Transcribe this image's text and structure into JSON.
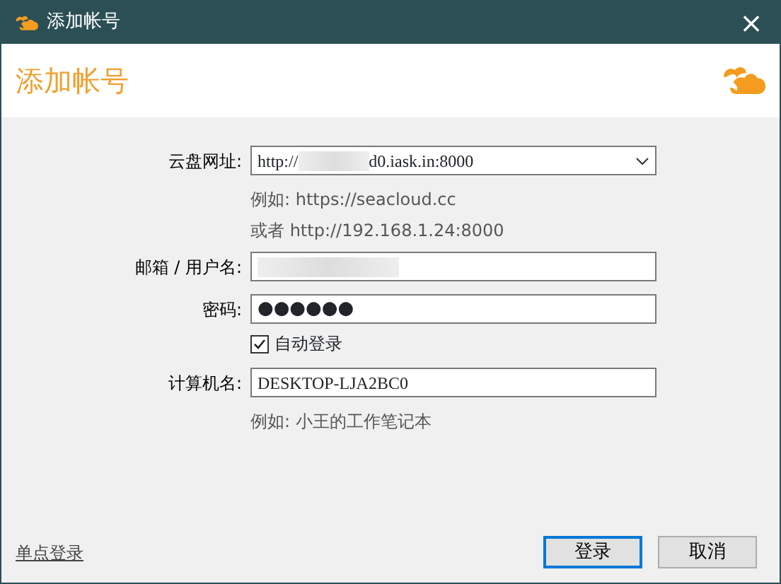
{
  "window": {
    "title": "添加帐号",
    "close": "×"
  },
  "header": {
    "title": "添加帐号"
  },
  "form": {
    "server": {
      "label": "云盘网址:",
      "value_start": "http://",
      "redacted": true,
      "value_end": "d0.iask.in:8000",
      "example": "例如:  https://seacloud.cc",
      "example2": "或者 http://192.168.1.24:8000"
    },
    "username": {
      "label": "邮箱 / 用户名:",
      "redacted": true
    },
    "password": {
      "label": "密码:",
      "value": "●●●●●●"
    },
    "auto_login": {
      "label": "自动登录",
      "checked": true
    },
    "computer": {
      "label": "计算机名:",
      "value": "DESKTOP-LJA2BC0",
      "example": "例如: 小王的工作笔记本"
    }
  },
  "footer": {
    "link": "单点登录",
    "buttons": [
      {
        "label": "登录",
        "default": true
      },
      {
        "label": "取消",
        "default": false
      }
    ]
  }
}
